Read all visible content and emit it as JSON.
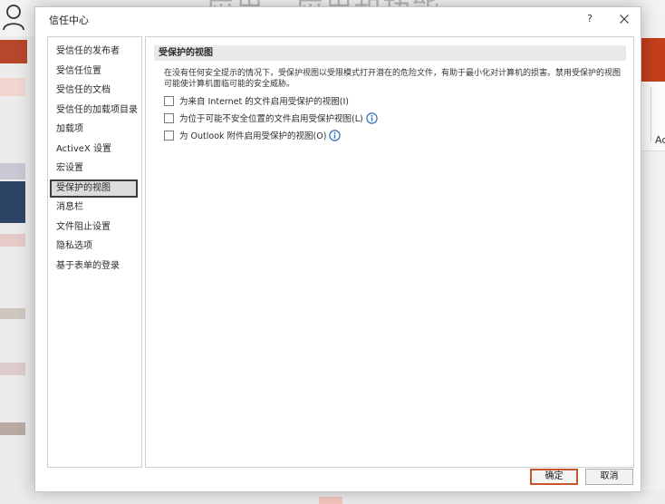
{
  "background": {
    "title_fragment": "应用 · 应用和功能",
    "right_panel_text": "Ac"
  },
  "dialog": {
    "title": "信任中心",
    "help_label": "?",
    "colors": {
      "accent": "#c6542f",
      "info_icon": "#2a6fb8",
      "ribbon": "#c43e1c"
    }
  },
  "nav": {
    "items": [
      {
        "label": "受信任的发布者"
      },
      {
        "label": "受信任位置"
      },
      {
        "label": "受信任的文档"
      },
      {
        "label": "受信任的加载项目录"
      },
      {
        "label": "加载项"
      },
      {
        "label": "ActiveX 设置"
      },
      {
        "label": "宏设置"
      },
      {
        "label": "受保护的视图",
        "selected": true
      },
      {
        "label": "消息栏"
      },
      {
        "label": "文件阻止设置"
      },
      {
        "label": "隐私选项"
      },
      {
        "label": "基于表单的登录"
      }
    ]
  },
  "content": {
    "section_title": "受保护的视图",
    "description": "在没有任何安全提示的情况下，受保护视图以受限模式打开潜在的危险文件，有助于最小化对计算机的损害。禁用受保护的视图可能使计算机面临可能的安全威胁。",
    "options": [
      {
        "label": "为来自 Internet 的文件启用受保护的视图(I)",
        "checked": false,
        "info": false
      },
      {
        "label": "为位于可能不安全位置的文件启用受保护视图(L)",
        "checked": false,
        "info": true
      },
      {
        "label": "为 Outlook 附件启用受保护的视图(O)",
        "checked": false,
        "info": true
      }
    ]
  },
  "footer": {
    "ok_label": "确定",
    "cancel_label": "取消"
  }
}
